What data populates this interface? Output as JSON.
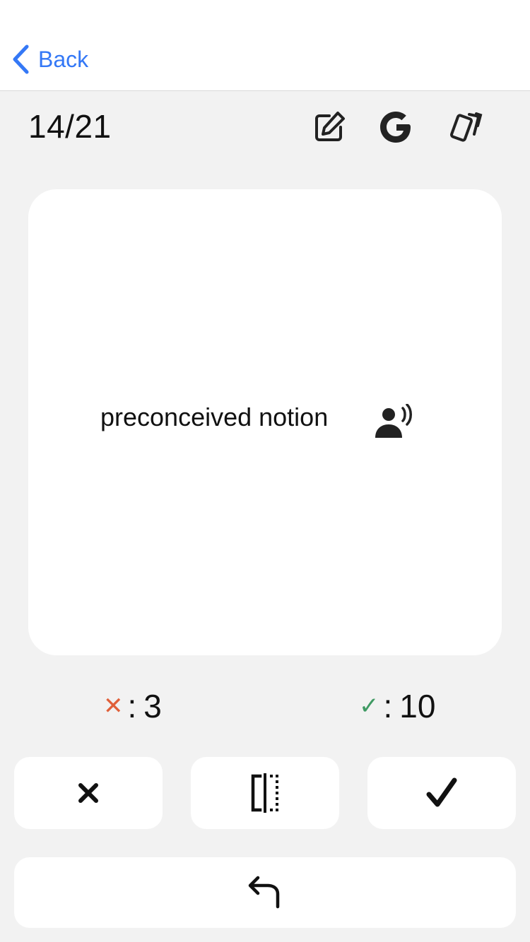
{
  "nav": {
    "back_label": "Back",
    "back_icon": "chevron-left-icon",
    "accent_color": "#3478f6"
  },
  "header": {
    "counter": "14/21",
    "icons": [
      "edit-icon",
      "google-icon",
      "cards-icon"
    ]
  },
  "card": {
    "word": "preconceived notion",
    "speak_icon": "speaking-person-icon"
  },
  "score": {
    "wrong_mark": "✕",
    "wrong_sep": ":",
    "wrong_count": "3",
    "wrong_color": "#e0603a",
    "right_mark": "✓",
    "right_sep": ":",
    "right_count": "10",
    "right_color": "#3f9a63"
  },
  "actions": {
    "wrong_icon": "x-icon",
    "flip_icon": "flip-card-icon",
    "right_icon": "checkmark-icon",
    "undo_icon": "undo-arrow-icon"
  }
}
